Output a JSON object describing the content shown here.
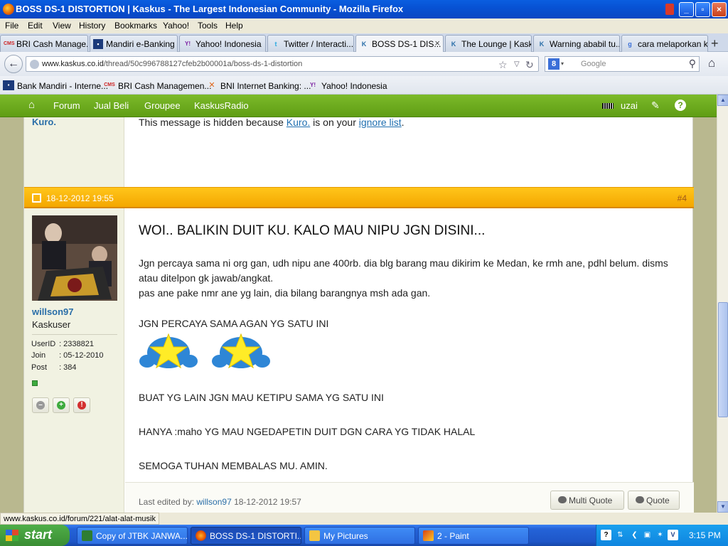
{
  "window": {
    "title": "BOSS DS-1 DISTORTION | Kaskus - The Largest Indonesian Community - Mozilla Firefox",
    "controls": [
      "_",
      "▫",
      "×"
    ]
  },
  "menu": [
    "File",
    "Edit",
    "View",
    "History",
    "Bookmarks",
    "Yahoo!",
    "Tools",
    "Help"
  ],
  "tabs": [
    {
      "label": "BRI Cash Manage...",
      "icon": "cms-icon",
      "glyph": "CMS"
    },
    {
      "label": "Mandiri e-Banking ...",
      "icon": "mandiri-icon",
      "glyph": "▪"
    },
    {
      "label": "Yahoo! Indonesia",
      "icon": "yahoo-icon",
      "glyph": "Y!"
    },
    {
      "label": "Twitter / Interacti...",
      "icon": "twitter-icon",
      "glyph": "t"
    },
    {
      "label": "BOSS DS-1 DIS...",
      "icon": "kaskus-icon",
      "glyph": "K",
      "active": true
    },
    {
      "label": "The Lounge | Kask...",
      "icon": "kaskus-icon",
      "glyph": "K"
    },
    {
      "label": "Warning ababil tu...",
      "icon": "kaskus-icon",
      "glyph": "K"
    },
    {
      "label": "cara melaporkan k...",
      "icon": "google-icon",
      "glyph": "g"
    }
  ],
  "nav": {
    "url_domain": "www.kaskus.co.id",
    "url_path": "/thread/50c996788127cfeb2b00001a/boss-ds-1-distortion",
    "search_placeholder": "Google",
    "search_engine_glyph": "8"
  },
  "bookmarks": [
    {
      "label": "Bank Mandiri - Interne...",
      "icon": "mandiri-icon",
      "glyph": "▪"
    },
    {
      "label": "BRI Cash Managemen...",
      "icon": "cms-icon",
      "glyph": "CMS"
    },
    {
      "label": "BNI Internet Banking: ...",
      "icon": "bni-icon",
      "glyph": "✕"
    },
    {
      "label": "Yahoo! Indonesia",
      "icon": "yahoo-icon",
      "glyph": "Y!"
    }
  ],
  "site_nav": {
    "items": [
      "Forum",
      "Jual Beli",
      "Groupee",
      "KaskusRadio"
    ],
    "user": "uzai"
  },
  "prev_post": {
    "username": "Kuro.",
    "message_before": "This message is hidden because ",
    "link_user": "Kuro.",
    "message_mid": " is on your ",
    "link_list": "ignore list",
    "message_after": "."
  },
  "post": {
    "date": "18-12-2012 19:55",
    "number": "#4",
    "author": {
      "name": "willson97",
      "rank": "Kaskuser",
      "info": [
        {
          "key": "UserID",
          "value": ": 2338821"
        },
        {
          "key": "Join",
          "value": ": 05-12-2010"
        },
        {
          "key": "Post",
          "value": ": 384"
        }
      ]
    },
    "title": "WOI.. BALIKIN DUIT KU. KALO MAU NIPU JGN DISINI...",
    "lines": [
      "Jgn percaya sama ni org gan, udh nipu ane 400rb. dia blg barang mau dikirim ke Medan, ke rmh ane, pdhl belum. disms",
      "atau ditelpon gk jawab/angkat.",
      "pas ane pake nmr ane yg lain, dia bilang barangnya msh ada gan.",
      "JGN PERCAYA SAMA AGAN YG SATU INI",
      "BUAT YG LAIN JGN MAU KETIPU SAMA YG SATU INI",
      "HANYA :maho YG MAU NGEDAPETIN DUIT DGN CARA YG TIDAK HALAL",
      "SEMOGA TUHAN MEMBALAS MU. AMIN."
    ],
    "last_edited_label": "Last edited by: ",
    "last_edited_by": "willson97",
    "last_edited_date": " 18-12-2012 19:57",
    "multi_quote": "Multi Quote",
    "quote": "Quote"
  },
  "status_url": "www.kaskus.co.id/forum/221/alat-alat-musik",
  "taskbar": {
    "start": "start",
    "tasks": [
      {
        "label": "Copy of JTBK JANWA...",
        "icon": "excel-icon"
      },
      {
        "label": "BOSS DS-1 DISTORTI...",
        "icon": "firefox-icon",
        "active": true
      },
      {
        "label": "My Pictures",
        "icon": "folder-icon"
      },
      {
        "label": "2 - Paint",
        "icon": "paint-icon"
      }
    ],
    "clock": "3:15 PM"
  }
}
